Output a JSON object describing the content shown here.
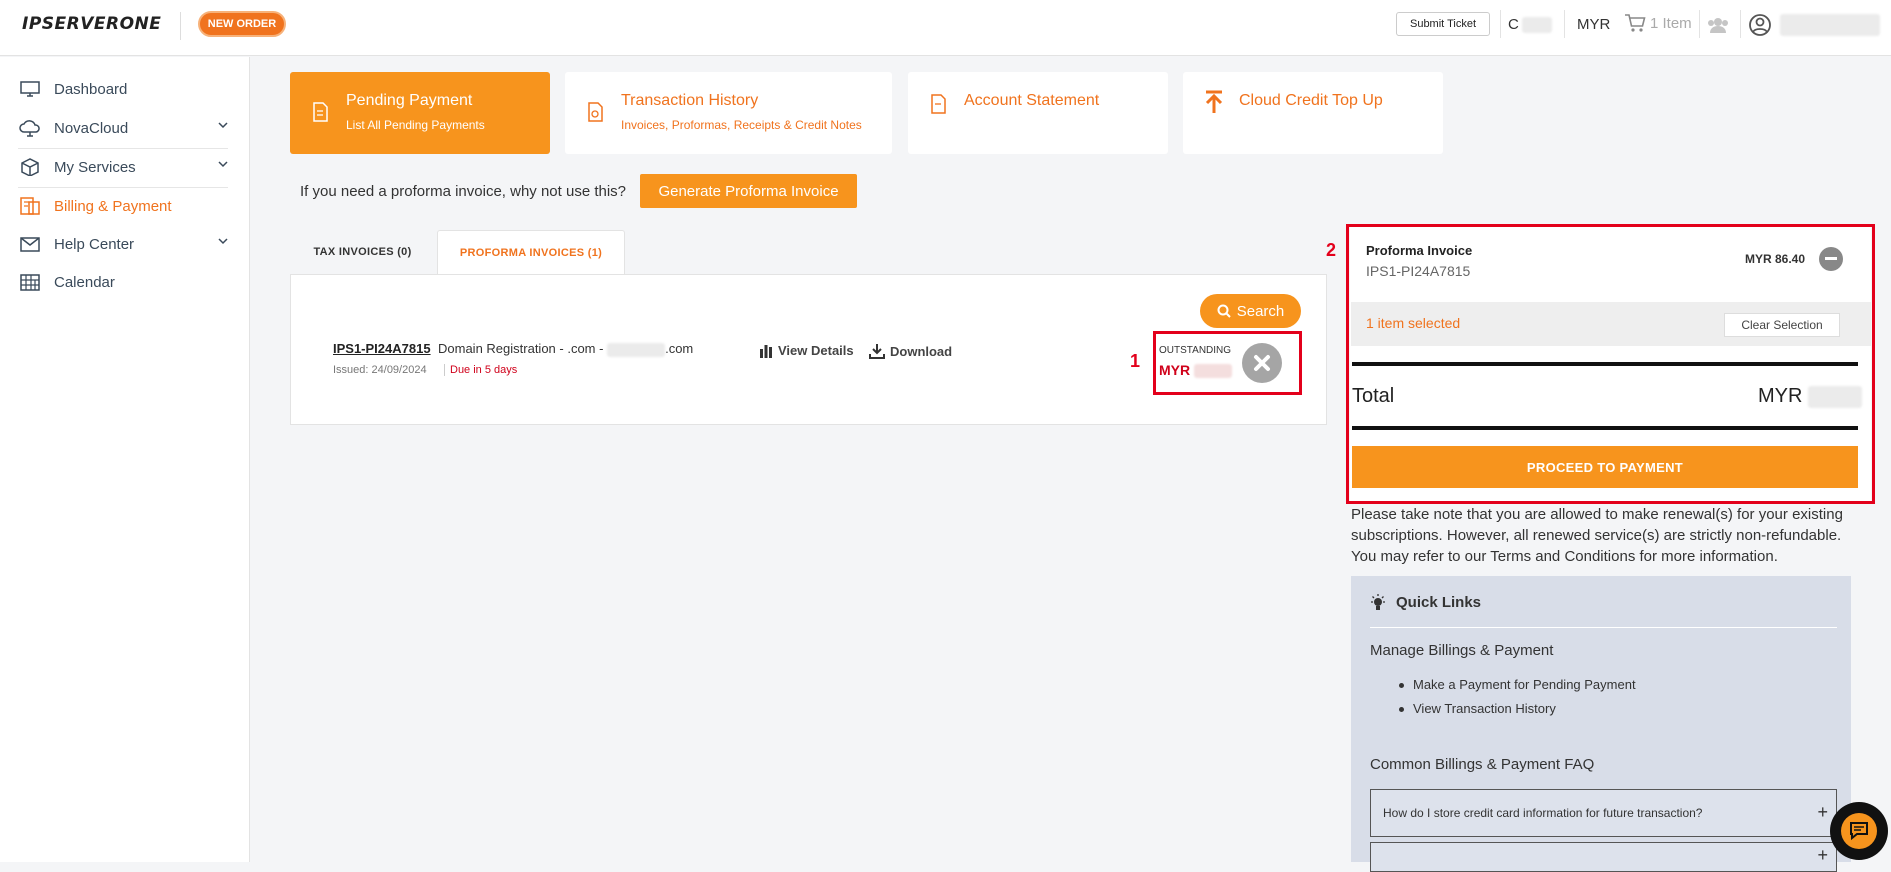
{
  "header": {
    "logo_text": "IPSERVERONE",
    "new_order": "NEW ORDER",
    "submit_ticket": "Submit Ticket",
    "user_initial": "C",
    "currency": "MYR",
    "cart_label": "1 Item"
  },
  "sidebar": {
    "items": [
      {
        "label": "Dashboard",
        "icon": "monitor-icon"
      },
      {
        "label": "NovaCloud",
        "icon": "cloud-icon"
      },
      {
        "label": "My Services",
        "icon": "box-icon"
      },
      {
        "label": "Billing & Payment",
        "icon": "billing-icon"
      },
      {
        "label": "Help Center",
        "icon": "mail-icon"
      },
      {
        "label": "Calendar",
        "icon": "calendar-icon"
      }
    ]
  },
  "cards": [
    {
      "title": "Pending Payment",
      "subtitle": "List All Pending Payments"
    },
    {
      "title": "Transaction History",
      "subtitle": "Invoices, Proformas, Receipts & Credit Notes"
    },
    {
      "title": "Account Statement",
      "subtitle": ""
    },
    {
      "title": "Cloud Credit Top Up",
      "subtitle": ""
    }
  ],
  "proforma_prompt": "If you need a proforma invoice, why not use this?",
  "generate_button": "Generate Proforma Invoice",
  "tabs": [
    {
      "label": "TAX INVOICES (0)"
    },
    {
      "label": "PROFORMA INVOICES (1)"
    }
  ],
  "search_button": "Search",
  "invoice": {
    "id": "IPS1-PI24A7815",
    "description_prefix": "Domain Registration - .com -",
    "description_suffix": ".com",
    "issued": "Issued: 24/09/2024",
    "due": "Due in 5 days",
    "view_details": "View Details",
    "download": "Download",
    "outstanding_label": "OUTSTANDING",
    "outstanding_currency": "MYR"
  },
  "annotations": {
    "one": "1",
    "two": "2"
  },
  "summary": {
    "title": "Proforma Invoice",
    "invoice_id": "IPS1-PI24A7815",
    "amount": "MYR 86.40",
    "selected_text": "1 item selected",
    "clear_selection": "Clear Selection",
    "total_label": "Total",
    "total_currency": "MYR",
    "proceed_button": "PROCEED TO PAYMENT",
    "note": "Please take note that you are allowed to make renewal(s) for your existing subscriptions. However, all renewed service(s) are strictly non-refundable. You may refer to our Terms and Conditions for more information."
  },
  "quick_links": {
    "title": "Quick Links",
    "section1": "Manage Billings & Payment",
    "links": [
      "Make a Payment for Pending Payment",
      "View Transaction History"
    ],
    "section2": "Common Billings & Payment FAQ",
    "faq": [
      "How do I store credit card information for future transaction?",
      ""
    ]
  },
  "colors": {
    "accent": "#f7941d",
    "accent_text": "#f0731e",
    "annotation": "#e3001b",
    "due": "#d0021b"
  }
}
